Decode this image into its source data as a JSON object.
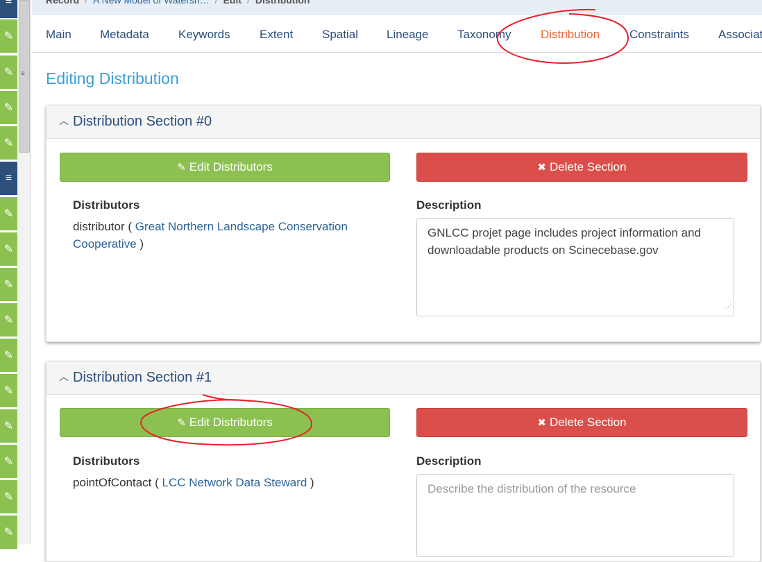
{
  "breadcrumb": {
    "items": [
      "Record",
      "A New Model of Watersh…",
      "Edit",
      "Distribution"
    ],
    "separator": "/"
  },
  "tabs": [
    "Main",
    "Metadata",
    "Keywords",
    "Extent",
    "Spatial",
    "Lineage",
    "Taxonomy",
    "Distribution",
    "Constraints",
    "Associat"
  ],
  "active_tab": "Distribution",
  "page_title": "Editing Distribution",
  "sections": [
    {
      "title": "Distribution Section #0",
      "edit_label": "Edit Distributors",
      "delete_label": "Delete Section",
      "distributors_label": "Distributors",
      "role": "distributor",
      "org": "Great Northern Landscape Conservation Cooperative",
      "description_label": "Description",
      "description": "GNLCC projet page includes project information and downloadable products on Scinecebase.gov"
    },
    {
      "title": "Distribution Section #1",
      "edit_label": "Edit Distributors",
      "delete_label": "Delete Section",
      "distributors_label": "Distributors",
      "role": "pointOfContact",
      "org": "LCC Network Data Steward",
      "description_label": "Description",
      "description_placeholder": "Describe the distribution of the resource"
    }
  ],
  "icons": {
    "rail": [
      "list-icon",
      "pencil-icon",
      "pencil-icon",
      "pencil-icon",
      "pencil-icon",
      "list-icon",
      "pencil-icon",
      "pencil-icon",
      "pencil-icon",
      "pencil-icon",
      "pencil-icon",
      "pencil-icon",
      "pencil-icon",
      "pencil-icon",
      "pencil-icon",
      "pencil-icon"
    ],
    "edit": "pencil-icon",
    "delete": "times-icon",
    "collapse": "chevron-up-icon"
  },
  "colors": {
    "accent": "#3a9fd8",
    "active_tab": "#e9683a",
    "green": "#8cc152",
    "red": "#da4f4b",
    "navy": "#2c4f7c",
    "annotation": "#e8232a"
  }
}
